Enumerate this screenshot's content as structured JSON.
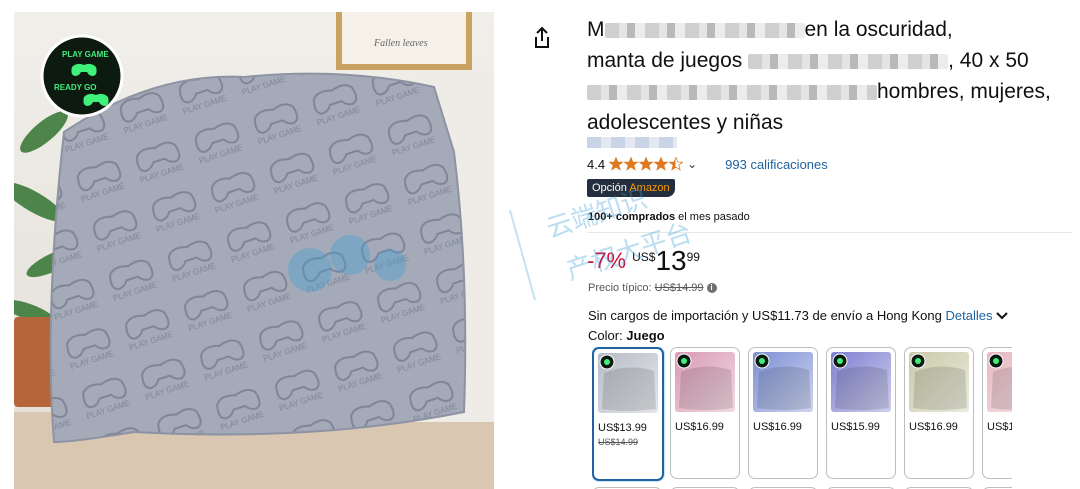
{
  "product": {
    "title_line1_visible": "en la oscuridad,",
    "title_line1_prefix": "M",
    "title_line2_prefix": "manta de juegos",
    "title_line2_suffix": ", 40 x 50",
    "title_line3_suffix": "hombres, mujeres,",
    "title_line4": "adolescentes y niñas"
  },
  "rating": {
    "value": "4.4",
    "stars": 4.4,
    "count_label": "993 calificaciones"
  },
  "badge": {
    "prefix": "Opción ",
    "brand": "Amazon"
  },
  "bought": {
    "bold": "100+ comprados",
    "rest": " el mes pasado"
  },
  "price": {
    "discount": "-7%",
    "currency": "US$",
    "whole": "13",
    "fraction": "99",
    "typical_label": "Precio típico:",
    "typical_value": "US$14.99"
  },
  "shipping": {
    "text": "Sin cargos de importación y US$11.73 de envío a Hong Kong ",
    "details": "Detalles"
  },
  "color": {
    "label": "Color: ",
    "value": "Juego"
  },
  "swatches": [
    {
      "price": "US$13.99",
      "old": "US$14.99",
      "tint": "#b7bcc6",
      "selected": true
    },
    {
      "price": "US$16.99",
      "old": "",
      "tint": "#d99ab3",
      "selected": false
    },
    {
      "price": "US$16.99",
      "old": "",
      "tint": "#7c8fd4",
      "selected": false
    },
    {
      "price": "US$15.99",
      "old": "",
      "tint": "#7e7fd0",
      "selected": false
    },
    {
      "price": "US$16.99",
      "old": "",
      "tint": "#c9c9a8",
      "selected": false
    },
    {
      "price": "US$1",
      "old": "",
      "tint": "#e7b7c0",
      "selected": false
    }
  ],
  "image": {
    "frame_text": "Fallen leaves",
    "badge_words": [
      "PLAY GAME",
      "READY GO"
    ]
  },
  "watermark": {
    "line1": "云端知识",
    "line2": "产权大平台"
  },
  "colors": {
    "link": "#2162a1",
    "discount": "#cc0c39",
    "star": "#de7921",
    "badge_bg": "#232f3e",
    "selected_border": "#2162a1"
  }
}
